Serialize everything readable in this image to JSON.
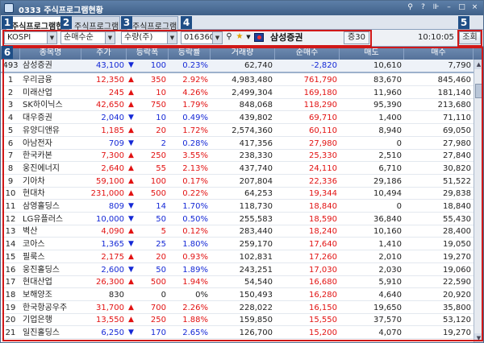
{
  "window": {
    "title": "0333 주식프로그램현황",
    "buttons": [
      "⚲",
      "?",
      "⊪",
      "–",
      "□",
      "×"
    ]
  },
  "tabs": [
    {
      "label": "주식프로그램현황",
      "active": true
    },
    {
      "label": "주식프로그램일자별",
      "active": false
    },
    {
      "label": "주식프로그램시간별",
      "active": false
    }
  ],
  "markers": [
    "1",
    "2",
    "3",
    "4",
    "5",
    "6"
  ],
  "toolbar": {
    "market": "KOSPI",
    "sort": "순매수순",
    "unit": "수량(주)",
    "code": "016360",
    "stock_name": "삼성증권",
    "badge": "증30",
    "time": "10:10:05",
    "query_label": "조회"
  },
  "columns": [
    "종목명",
    "주가",
    "등락폭",
    "등락률",
    "거래량",
    "순매수",
    "매도",
    "매수"
  ],
  "summary": {
    "rank": "493",
    "name": "삼성증권",
    "price": "43,100",
    "dir": "down",
    "change": "100",
    "rate": "0.23%",
    "volume": "62,740",
    "net": "-2,820",
    "sell": "10,610",
    "buy": "7,790"
  },
  "rows": [
    {
      "rank": "1",
      "name": "우리금융",
      "price": "12,350",
      "dir": "up",
      "change": "350",
      "rate": "2.92%",
      "volume": "4,983,480",
      "net": "761,790",
      "sell": "83,670",
      "buy": "845,460"
    },
    {
      "rank": "2",
      "name": "미래산업",
      "price": "245",
      "dir": "up",
      "change": "10",
      "rate": "4.26%",
      "volume": "2,499,304",
      "net": "169,180",
      "sell": "11,960",
      "buy": "181,140"
    },
    {
      "rank": "3",
      "name": "SK하이닉스",
      "price": "42,650",
      "dir": "up",
      "change": "750",
      "rate": "1.79%",
      "volume": "848,068",
      "net": "118,290",
      "sell": "95,390",
      "buy": "213,680"
    },
    {
      "rank": "4",
      "name": "대우증권",
      "price": "2,040",
      "dir": "down",
      "change": "10",
      "rate": "0.49%",
      "volume": "439,802",
      "net": "69,710",
      "sell": "1,400",
      "buy": "71,110"
    },
    {
      "rank": "5",
      "name": "유양디앤유",
      "price": "1,185",
      "dir": "up",
      "change": "20",
      "rate": "1.72%",
      "volume": "2,574,360",
      "net": "60,110",
      "sell": "8,940",
      "buy": "69,050"
    },
    {
      "rank": "6",
      "name": "아남전자",
      "price": "709",
      "dir": "down",
      "change": "2",
      "rate": "0.28%",
      "volume": "417,356",
      "net": "27,980",
      "sell": "0",
      "buy": "27,980"
    },
    {
      "rank": "7",
      "name": "한국카본",
      "price": "7,300",
      "dir": "up",
      "change": "250",
      "rate": "3.55%",
      "volume": "238,330",
      "net": "25,330",
      "sell": "2,510",
      "buy": "27,840"
    },
    {
      "rank": "8",
      "name": "웅진에너지",
      "price": "2,640",
      "dir": "up",
      "change": "55",
      "rate": "2.13%",
      "volume": "437,740",
      "net": "24,110",
      "sell": "6,710",
      "buy": "30,820"
    },
    {
      "rank": "9",
      "name": "기아차",
      "price": "59,100",
      "dir": "up",
      "change": "100",
      "rate": "0.17%",
      "volume": "207,804",
      "net": "22,336",
      "sell": "29,186",
      "buy": "51,522"
    },
    {
      "rank": "10",
      "name": "현대차",
      "price": "231,000",
      "dir": "up",
      "change": "500",
      "rate": "0.22%",
      "volume": "64,253",
      "net": "19,344",
      "sell": "10,494",
      "buy": "29,838"
    },
    {
      "rank": "11",
      "name": "삼영홀딩스",
      "price": "809",
      "dir": "down",
      "change": "14",
      "rate": "1.70%",
      "volume": "118,730",
      "net": "18,840",
      "sell": "0",
      "buy": "18,840"
    },
    {
      "rank": "12",
      "name": "LG유플러스",
      "price": "10,000",
      "dir": "down",
      "change": "50",
      "rate": "0.50%",
      "volume": "255,583",
      "net": "18,590",
      "sell": "36,840",
      "buy": "55,430"
    },
    {
      "rank": "13",
      "name": "벽산",
      "price": "4,090",
      "dir": "up",
      "change": "5",
      "rate": "0.12%",
      "volume": "283,440",
      "net": "18,240",
      "sell": "10,160",
      "buy": "28,400"
    },
    {
      "rank": "14",
      "name": "코아스",
      "price": "1,365",
      "dir": "down",
      "change": "25",
      "rate": "1.80%",
      "volume": "259,170",
      "net": "17,640",
      "sell": "1,410",
      "buy": "19,050"
    },
    {
      "rank": "15",
      "name": "필룩스",
      "price": "2,175",
      "dir": "up",
      "change": "20",
      "rate": "0.93%",
      "volume": "102,831",
      "net": "17,260",
      "sell": "2,010",
      "buy": "19,270"
    },
    {
      "rank": "16",
      "name": "웅진홀딩스",
      "price": "2,600",
      "dir": "down",
      "change": "50",
      "rate": "1.89%",
      "volume": "243,251",
      "net": "17,030",
      "sell": "2,030",
      "buy": "19,060"
    },
    {
      "rank": "17",
      "name": "현대산업",
      "price": "26,300",
      "dir": "up",
      "change": "500",
      "rate": "1.94%",
      "volume": "54,540",
      "net": "16,680",
      "sell": "5,910",
      "buy": "22,590"
    },
    {
      "rank": "18",
      "name": "보해양조",
      "price": "830",
      "dir": "none",
      "change": "0",
      "rate": "0%",
      "volume": "150,493",
      "net": "16,280",
      "sell": "4,640",
      "buy": "20,920"
    },
    {
      "rank": "19",
      "name": "한국항공우주",
      "price": "31,700",
      "dir": "up",
      "change": "700",
      "rate": "2.26%",
      "volume": "228,022",
      "net": "16,150",
      "sell": "19,650",
      "buy": "35,800"
    },
    {
      "rank": "20",
      "name": "기업은행",
      "price": "13,550",
      "dir": "up",
      "change": "250",
      "rate": "1.88%",
      "volume": "159,850",
      "net": "15,550",
      "sell": "37,570",
      "buy": "53,120"
    },
    {
      "rank": "21",
      "name": "일진홀딩스",
      "price": "6,250",
      "dir": "down",
      "change": "170",
      "rate": "2.65%",
      "volume": "126,700",
      "net": "15,200",
      "sell": "4,070",
      "buy": "19,270"
    }
  ],
  "colors": {
    "up": "#e21212",
    "down": "#1428d6",
    "header": "#5f7da4",
    "highlight": "#d01818",
    "marker": "#1f4e86"
  }
}
